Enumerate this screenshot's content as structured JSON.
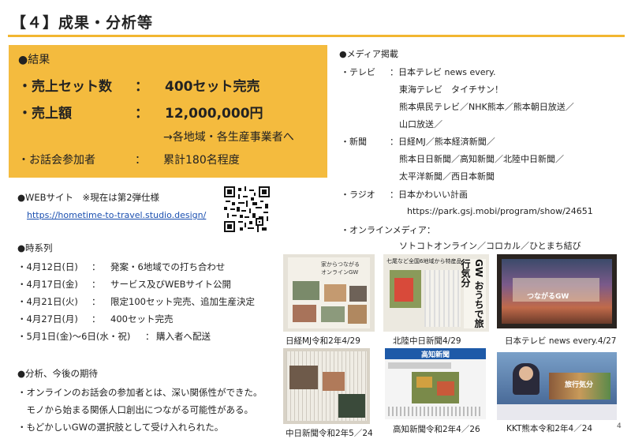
{
  "title": "【４】成果・分析等",
  "results": {
    "heading": "●結果",
    "rows": [
      {
        "label": "・売上セット数",
        "sep": "：",
        "value": "400セット完売"
      },
      {
        "label": "・売上額",
        "sep": "：",
        "value": "12,000,000円"
      }
    ],
    "note": "→各地域・各生産事業者へ",
    "participants": {
      "label": "・お話会参加者",
      "sep": "：",
      "value": "累計180名程度"
    }
  },
  "web": {
    "heading": "●WEBサイト　※現在は第2弾仕様",
    "url": "https://hometime-to-travel.studio.design/"
  },
  "timeline": {
    "heading": "●時系列",
    "items": [
      {
        "date": "・4月12日(日)",
        "sep": "：",
        "text": "発案・6地域での打ち合わせ"
      },
      {
        "date": "・4月17日(金)",
        "sep": "：",
        "text": "サービス及びWEBサイト公開"
      },
      {
        "date": "・4月21日(火)",
        "sep": "：",
        "text": "限定100セット完売、追加生産決定"
      },
      {
        "date": "・4月27日(月)",
        "sep": "：",
        "text": "400セット完売"
      },
      {
        "date": "・5月1日(金)～6日(水・祝)",
        "sep": "：",
        "text": "購入者へ配送"
      }
    ]
  },
  "analysis": {
    "heading": "●分析、今後の期待",
    "lines": [
      "・オンラインのお話会の参加者とは、深い関係性ができた。",
      "　モノから始まる関係人口創出につながる可能性がある。",
      "・もどかしいGWの選択肢として受け入れられた。"
    ]
  },
  "media": {
    "heading": "●メディア掲載",
    "tv_label": "・テレビ",
    "tv_lines": [
      "：日本テレビ news every.",
      "東海テレビ　タイチサン！",
      "熊本県民テレビ／NHK熊本／熊本朝日放送／",
      "山口放送／"
    ],
    "paper_label": "・新聞",
    "paper_lines": [
      "：日経MJ／熊本経済新聞／",
      "熊本日日新聞／高知新聞／北陸中日新聞／",
      "太平洋新聞／西日本新聞"
    ],
    "radio_label": "・ラジオ",
    "radio_lines": [
      "：日本かわいい計画",
      "https://park.gsj.mobi/program/show/24651"
    ],
    "online_label": "・オンラインメディア：",
    "online_lines": [
      "ソトコトオンライン／コロカル／ひとまち結び"
    ]
  },
  "photos": {
    "captions": [
      "日経MJ令和2年4/29",
      "北陸中日新聞4/29",
      "日本テレビ news every.4/27",
      "中日新聞令和2年5／24",
      "高知新聞令和2年4／26",
      "KKT熊本令和2年4／24"
    ],
    "texts": {
      "p1_headline": "家からつながる オンラインGW",
      "p2_headline": "七尾など全国6地域から特産品",
      "p2_vertical": "GW おうちで旅行気分",
      "p3_overlay": "つながるGW",
      "p5_masthead": "高知新聞",
      "p6_overlay": "旅行気分"
    }
  },
  "page_number": "4",
  "colors": {
    "accent": "#f2b630",
    "box": "#f4bb3e",
    "link": "#1a4fb0"
  }
}
